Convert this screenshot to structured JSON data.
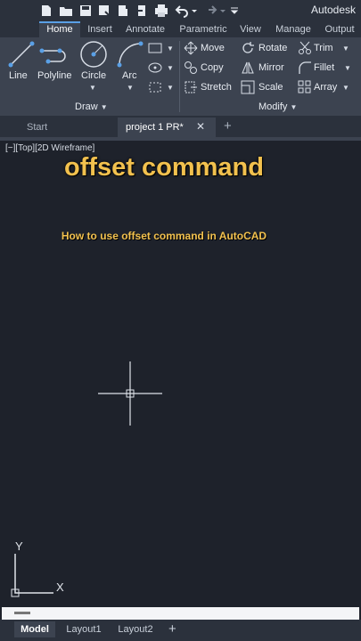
{
  "app": {
    "title": "Autodesk",
    "accent": "#5aa0e6",
    "overlay_color": "#f2c14e"
  },
  "quick_access": {
    "icons": [
      "new-icon",
      "open-icon",
      "save-icon",
      "save-as-icon",
      "upload-icon",
      "export-icon",
      "print-icon",
      "undo-icon",
      "redo-icon",
      "customize-icon"
    ]
  },
  "ribbon": {
    "tabs": [
      {
        "label": "Home",
        "active": true
      },
      {
        "label": "Insert"
      },
      {
        "label": "Annotate"
      },
      {
        "label": "Parametric"
      },
      {
        "label": "View"
      },
      {
        "label": "Manage"
      },
      {
        "label": "Output"
      }
    ],
    "draw": {
      "line": "Line",
      "polyline": "Polyline",
      "circle": "Circle",
      "arc": "Arc",
      "panel": "Draw"
    },
    "modify": {
      "move": "Move",
      "rotate": "Rotate",
      "trim": "Trim",
      "copy": "Copy",
      "mirror": "Mirror",
      "fillet": "Fillet",
      "stretch": "Stretch",
      "scale": "Scale",
      "array": "Array",
      "panel": "Modify"
    }
  },
  "doc_tabs": {
    "start": "Start",
    "active": "project 1 PR*",
    "close": "✕",
    "add": "+"
  },
  "viewport": {
    "label": "[−][Top][2D Wireframe]",
    "overlay_title": "offset command",
    "overlay_subtitle": "How to use offset command in AutoCAD",
    "ucs_y": "Y",
    "ucs_x": "X"
  },
  "layouts": {
    "tabs": [
      {
        "label": "Model",
        "active": true
      },
      {
        "label": "Layout1"
      },
      {
        "label": "Layout2"
      }
    ],
    "add": "+"
  }
}
